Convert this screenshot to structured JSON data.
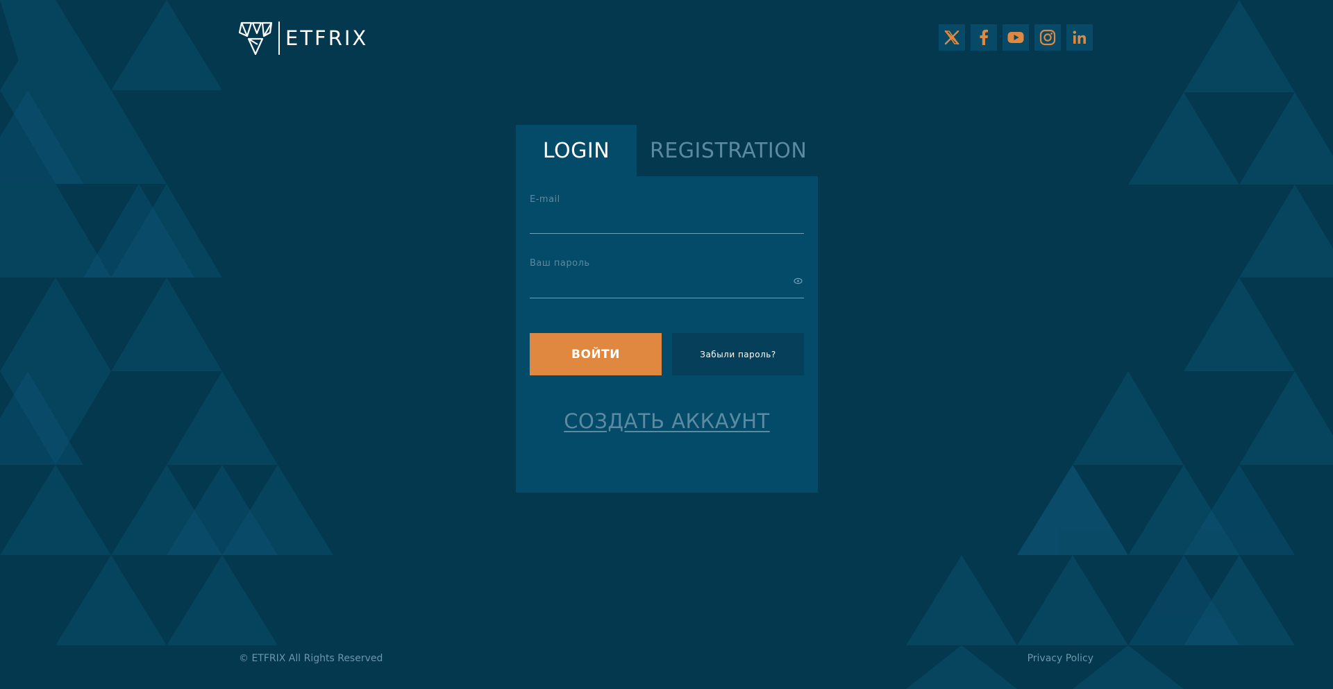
{
  "brand": {
    "name": "ETFRIX"
  },
  "social": [
    {
      "icon": "x-twitter-icon",
      "name": "social-x-button"
    },
    {
      "icon": "facebook-icon",
      "name": "social-facebook-button"
    },
    {
      "icon": "youtube-icon",
      "name": "social-youtube-button"
    },
    {
      "icon": "instagram-icon",
      "name": "social-instagram-button"
    },
    {
      "icon": "linkedin-icon",
      "name": "social-linkedin-button"
    }
  ],
  "tabs": {
    "login": "LOGIN",
    "registration": "REGISTRATION"
  },
  "form": {
    "email_label": "E-mail",
    "email_value": "",
    "password_label": "Ваш пароль",
    "password_value": "",
    "submit_label": "ВОЙТИ",
    "forgot_label": "Забыли пароль?",
    "create_account_label": "СОЗДАТЬ АККАУНТ"
  },
  "footer": {
    "copyright": "© ETFRIX All Rights Reserved",
    "privacy": "Privacy Policy"
  },
  "colors": {
    "background": "#03384f",
    "panel": "#044a69",
    "accent": "#e0883f",
    "secondary_button": "#063f59",
    "muted_text": "#5a8ba3"
  }
}
